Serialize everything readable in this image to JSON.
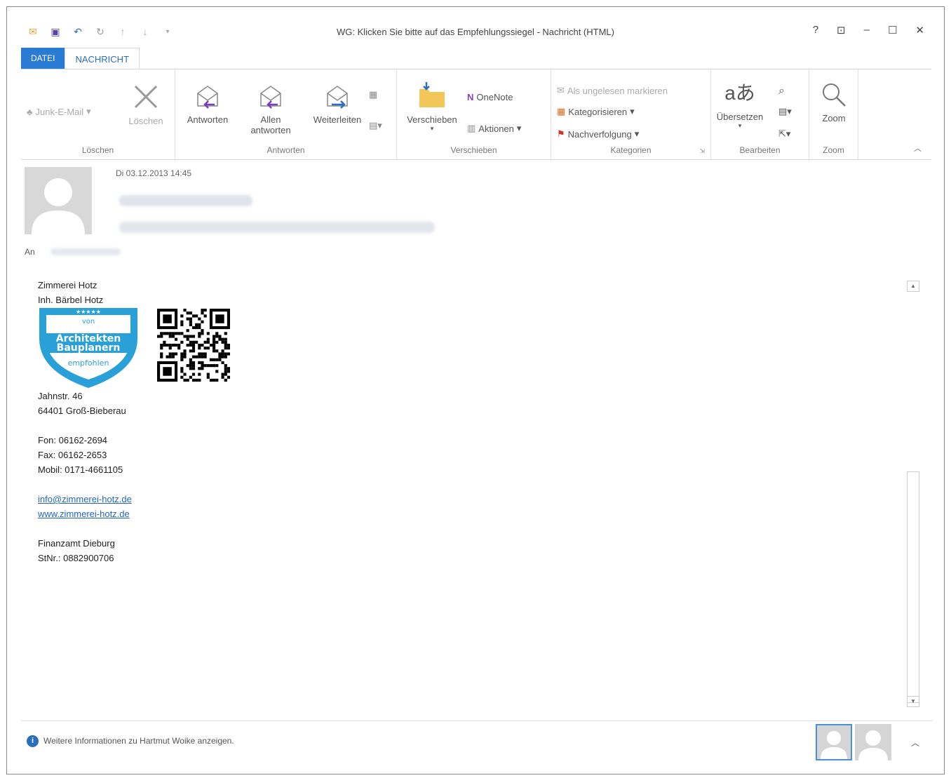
{
  "window": {
    "title": "WG: Klicken Sie bitte auf das Empfehlungssiegel - Nachricht (HTML)",
    "controls": {
      "help": "?",
      "restore_ribbon": "⊡",
      "minimize": "–",
      "maximize": "☐",
      "close": "✕"
    }
  },
  "tabs": {
    "file": "DATEI",
    "message": "NACHRICHT"
  },
  "ribbon": {
    "loeschen": {
      "junk": "Junk-E-Mail",
      "delete": "Löschen",
      "label": "Löschen"
    },
    "antworten": {
      "reply": "Antworten",
      "reply_all_1": "Allen",
      "reply_all_2": "antworten",
      "forward": "Weiterleiten",
      "label": "Antworten"
    },
    "verschieben": {
      "move": "Verschieben",
      "onenote": "OneNote",
      "actions": "Aktionen",
      "label": "Verschieben"
    },
    "kategorien": {
      "mark_unread": "Als ungelesen markieren",
      "categorize": "Kategorisieren",
      "followup": "Nachverfolgung",
      "label": "Kategorien"
    },
    "bearbeiten": {
      "translate": "Übersetzen",
      "label": "Bearbeiten"
    },
    "zoom": {
      "zoom": "Zoom",
      "label": "Zoom"
    }
  },
  "header": {
    "date": "Di 03.12.2013 14:45",
    "to_label": "An"
  },
  "body": {
    "company": "Zimmerei Hotz",
    "owner": "Inh. Bärbel Hotz",
    "street": "Jahnstr. 46",
    "city": "64401 Groß-Bieberau",
    "phone": "Fon: 06162-2694",
    "fax": "Fax: 06162-2653",
    "mobile": "Mobil: 0171-4661105",
    "email": "info@zimmerei-hotz.de",
    "web": "www.zimmerei-hotz.de",
    "tax_office": "Finanzamt Dieburg",
    "tax_no": "StNr.: 0882900706",
    "seal": {
      "stars": "★★★★★",
      "von": "von",
      "line1": "Architekten",
      "line2": "Bauplanern",
      "line3": "empfohlen"
    }
  },
  "footer": {
    "info": "Weitere Informationen zu Hartmut Woike anzeigen.",
    "info_icon": "i"
  }
}
